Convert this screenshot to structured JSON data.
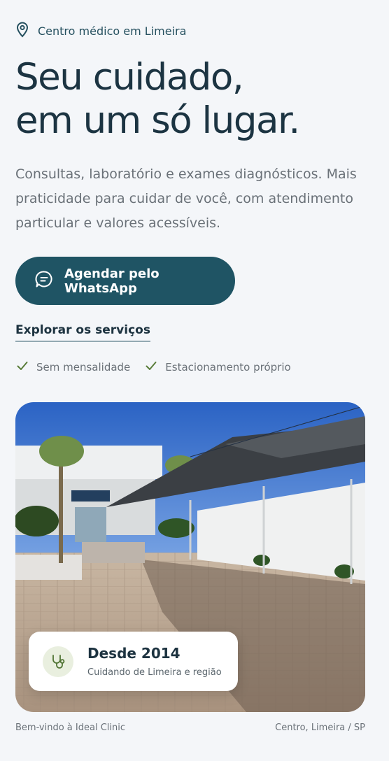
{
  "location": {
    "text": "Centro médico em Limeira",
    "icon": "map-pin-icon"
  },
  "headline": {
    "line1": "Seu cuidado,",
    "line2": "em um só lugar."
  },
  "lead": "Consultas, laboratório e exames diagnósticos. Mais praticidade para cuidar de você, com atendimento particular e valores acessíveis.",
  "cta": {
    "label": "Agendar pelo WhatsApp",
    "icon": "chat-icon"
  },
  "explore_link": "Explorar os serviços",
  "features": [
    {
      "label": "Sem mensalidade",
      "icon": "check-icon"
    },
    {
      "label": "Estacionamento próprio",
      "icon": "check-icon"
    }
  ],
  "badge": {
    "title": "Desde 2014",
    "subtitle": "Cuidando de Limeira e região",
    "icon": "stethoscope-icon"
  },
  "captions": {
    "left": "Bem-vindo à Ideal Clinic",
    "right": "Centro, Limeira / SP"
  },
  "colors": {
    "primary": "#1f5464",
    "text": "#1c3442",
    "muted": "#6a7178",
    "check": "#5a7d3a",
    "background": "#f4f6f9"
  }
}
